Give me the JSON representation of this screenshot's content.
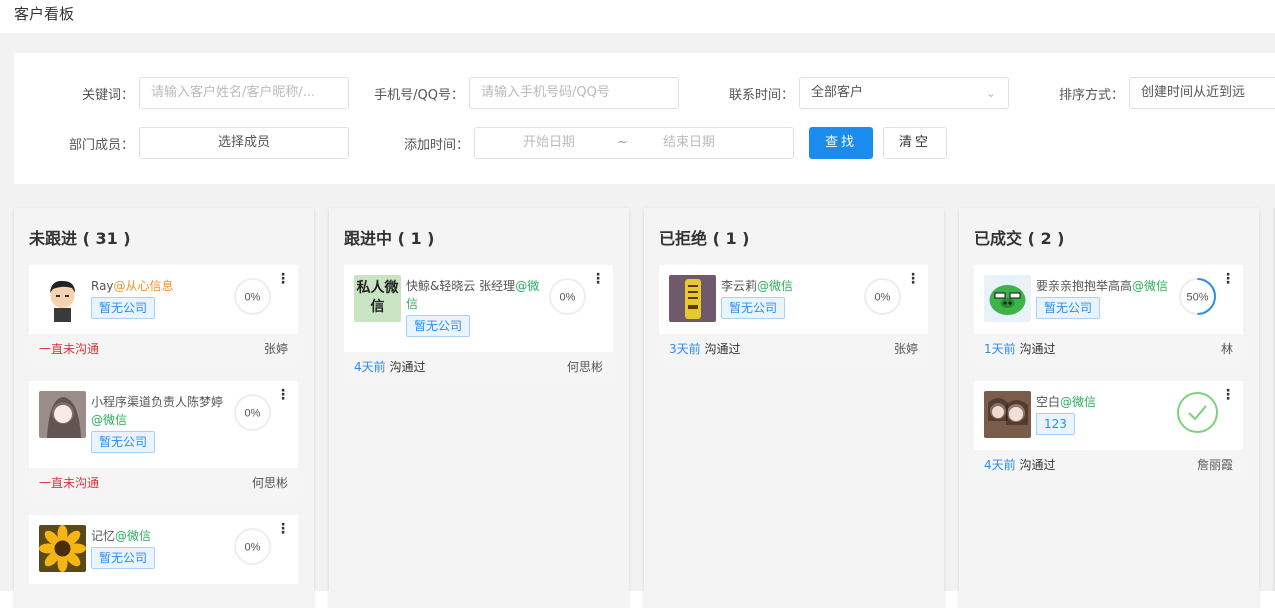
{
  "page": {
    "title": "客户看板"
  },
  "filters": {
    "keyword": {
      "label": "关键词：",
      "placeholder": "请输入客户姓名/客户昵称/..."
    },
    "phone": {
      "label": "手机号/QQ号：",
      "placeholder": "请输入手机号码/QQ号"
    },
    "contact_time": {
      "label": "联系时间：",
      "value": "全部客户"
    },
    "sort": {
      "label": "排序方式：",
      "value": "创建时间从近到远"
    },
    "department": {
      "label": "部门成员：",
      "value": "选择成员"
    },
    "add_time": {
      "label": "添加时间：",
      "start": "开始日期",
      "sep": "~",
      "end": "结束日期"
    },
    "search_button": "查找",
    "clear_button": "清空"
  },
  "columns": [
    {
      "title": "未跟进 ( 31 )",
      "cards": [
        {
          "name": "Ray",
          "source": "@从心信息",
          "source_color": "orange",
          "tag": "暂无公司",
          "progress": "0%",
          "footer_left": "一直未沟通",
          "footer_right": "张婷"
        },
        {
          "name": "小程序渠道负责人陈梦婷",
          "source": "@微信",
          "source_color": "green",
          "tag": "暂无公司",
          "progress": "0%",
          "footer_left": "一直未沟通",
          "footer_right": "何思彬"
        },
        {
          "name": "记忆",
          "source": "@微信",
          "source_color": "green",
          "tag": "暂无公司",
          "progress": "0%"
        }
      ]
    },
    {
      "title": "跟进中 ( 1 )",
      "cards": [
        {
          "avatar_text": "私人微信",
          "name": "快鲸&轻晓云 张经理",
          "source": "@微信",
          "source_color": "green",
          "tag": "暂无公司",
          "progress": "0%",
          "footer_days": "4天前",
          "footer_left": "沟通过",
          "footer_right": "何思彬"
        }
      ]
    },
    {
      "title": "已拒绝 ( 1 )",
      "cards": [
        {
          "name": "李云莉",
          "source": "@微信",
          "source_color": "green",
          "tag": "暂无公司",
          "progress": "0%",
          "footer_days": "3天前",
          "footer_left": "沟通过",
          "footer_right": "张婷"
        }
      ]
    },
    {
      "title": "已成交 ( 2 )",
      "cards": [
        {
          "name": "要亲亲抱抱举高高",
          "source": "@微信",
          "source_color": "green",
          "tag": "暂无公司",
          "progress": "50%",
          "progress_fraction": 0.5,
          "footer_days": "1天前",
          "footer_left": "沟通过",
          "footer_right": "林"
        },
        {
          "name": "空白",
          "source": "@微信",
          "source_color": "green",
          "tag": "123",
          "progress_state": "complete",
          "footer_days": "4天前",
          "footer_left": "沟通过",
          "footer_right": "詹丽霞"
        }
      ]
    }
  ],
  "colors": {
    "primary": "#1a8cf0",
    "green": "#2bad5c",
    "orange": "#f2912a",
    "red": "#d9363e",
    "done": "#7ed07e"
  }
}
